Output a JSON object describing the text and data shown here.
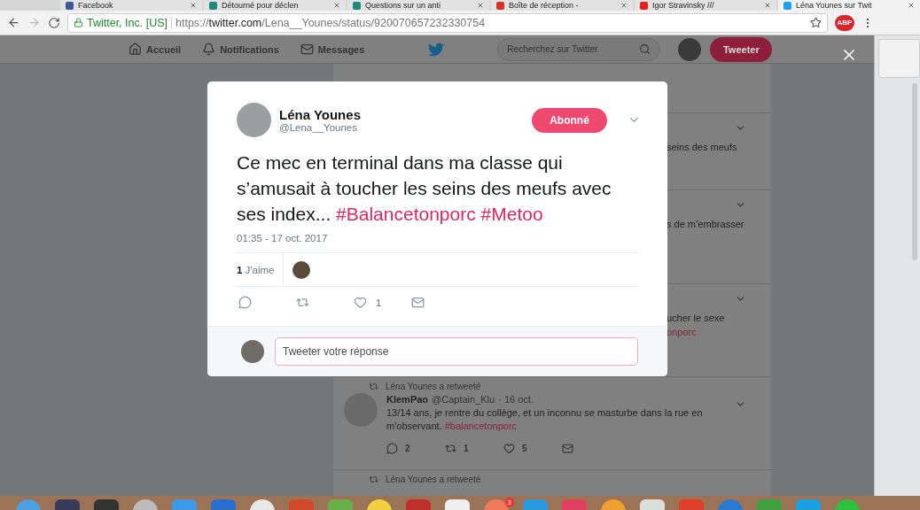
{
  "browser": {
    "tabs": [
      {
        "title": "Facebook",
        "selected": false,
        "color": "#3b5998"
      },
      {
        "title": "Détourné pour déclen",
        "selected": false,
        "color": "#1e8a7a"
      },
      {
        "title": "Questions sur un anti",
        "selected": false,
        "color": "#1e8a7a"
      },
      {
        "title": "Boîte de réception - ",
        "selected": false,
        "color": "#d93025"
      },
      {
        "title": "Igor Stravinsky ///",
        "selected": false,
        "color": "#e62117"
      },
      {
        "title": "Léna Younes sur Twit",
        "selected": true,
        "color": "#1da1f2"
      }
    ],
    "address": {
      "site_identity": "Twitter, Inc. [US]",
      "scheme": "https://",
      "host": "twitter.com",
      "path": "/Lena__Younes/status/920070657232330754"
    },
    "extension_badge": "ABP"
  },
  "nav": {
    "items": [
      {
        "label": "Accueil",
        "kind": "home"
      },
      {
        "label": "Notifications",
        "kind": "bell"
      },
      {
        "label": "Messages",
        "kind": "mail"
      }
    ],
    "search": {
      "placeholder": "Recherchez sur Twitter"
    },
    "tweet_button": "Tweeter"
  },
  "timeline": {
    "fragments": [
      {
        "lines": [
          {
            "text": "seins des meufs",
            "kind": "plain"
          }
        ]
      },
      {
        "lines": [
          {
            "text": "s de m’embrasser",
            "kind": "plain"
          }
        ]
      },
      {
        "lines": [
          {
            "text": "ucher le sexe",
            "kind": "plain"
          },
          {
            "text": "onporc",
            "kind": "hashtag"
          }
        ]
      }
    ],
    "retweet_note": "Léna Younes a retweeté",
    "tweet": {
      "name": "KlemPao",
      "handle": "@Captain_Klu",
      "date": "· 16 oct.",
      "text": "13/14 ans, je rentre du collège, et un inconnu se masturbe dans la rue en m'observant.",
      "hashtag": "#balancetonporc",
      "actions": [
        {
          "kind": "reply",
          "count": "2"
        },
        {
          "kind": "retweet",
          "count": "1"
        },
        {
          "kind": "like",
          "count": "5"
        },
        {
          "kind": "dm"
        }
      ]
    },
    "next_retweet_note": "Léna Younes a retweeté"
  },
  "modal": {
    "name": "Léna Younes",
    "handle": "@Lena__Younes",
    "follow_button": "Abonné",
    "text": "Ce mec en terminal dans ma classe qui s’amusait à toucher les seins des meufs avec ses index...",
    "hashtags": [
      "#Balancetonporc",
      "#Metoo"
    ],
    "timestamp": "01:35 - 17 oct. 2017",
    "likes_count": "1",
    "likes_label": "J'aime",
    "actions": [
      {
        "kind": "reply"
      },
      {
        "kind": "retweet"
      },
      {
        "kind": "like",
        "count": "1"
      },
      {
        "kind": "dm"
      }
    ],
    "reply": {
      "placeholder": "Tweeter votre réponse"
    }
  },
  "dock": {
    "badge": "3"
  }
}
